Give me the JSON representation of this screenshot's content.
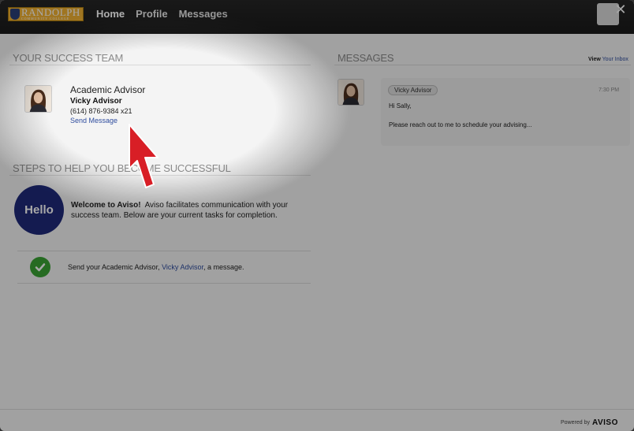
{
  "nav": {
    "logo_text": "RANDOLPH",
    "logo_subtext": "COMMUNITY COLLEGE",
    "items": [
      {
        "label": "Home",
        "active": true
      },
      {
        "label": "Profile",
        "active": false
      },
      {
        "label": "Messages",
        "active": false
      }
    ],
    "close_icon": "close-icon",
    "close_glyph": "✕"
  },
  "team": {
    "title": "YOUR SUCCESS TEAM",
    "role": "Academic Advisor",
    "name": "Vicky Advisor",
    "phone": "(614) 876-9384 x21",
    "link": "Send Message"
  },
  "steps": {
    "title": "STEPS TO HELP YOU BECOME SUCCESSFUL",
    "hello": "Hello",
    "welcome_bold": "Welcome to Aviso!",
    "welcome_text": "Aviso facilitates communication with your success team.   Below are your current tasks for completion.",
    "task_prefix": "Send your Academic Advisor,",
    "task_link": "Vicky Advisor",
    "task_suffix": ", a message."
  },
  "messages": {
    "title": "MESSAGES",
    "view_inbox_bold": "View",
    "view_inbox_rest": "Your Inbox",
    "sender": "Vicky Advisor",
    "time": "7:30 PM",
    "greeting": "Hi Sally,",
    "body": "Please reach out to me to schedule your advising..."
  },
  "footer": {
    "powered_by": "Powered by",
    "brand": "AVISO"
  },
  "colors": {
    "accent_link": "#2f4d9e",
    "hello_circle": "#1f2a7a",
    "check": "#3aa335",
    "cursor": "#d81e26"
  }
}
